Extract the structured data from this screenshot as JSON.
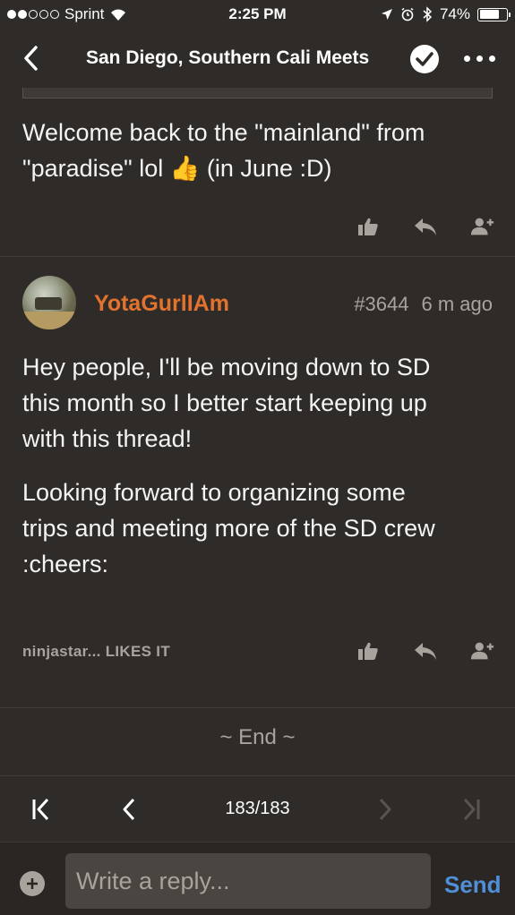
{
  "status_bar": {
    "carrier": "Sprint",
    "time": "2:25 PM",
    "battery": "74%",
    "battery_level": 0.74,
    "signal_bars_filled": 2,
    "signal_bars_total": 5
  },
  "nav": {
    "title": "San Diego, Southern Cali Meets",
    "back_icon": "chevron-left-icon",
    "check_icon": "check-icon",
    "more_icon": "more-icon"
  },
  "previous_post": {
    "text_line1": "Welcome back to the \"mainland\" from",
    "text_line2_before": "\"paradise\" lol",
    "emoji": "👍",
    "text_line2_after": "(in June :D)"
  },
  "post": {
    "username": "YotaGurlIAm",
    "number": "#3644",
    "time": "6 m ago",
    "paragraph1_line1": "Hey people, I'll be moving down to SD",
    "paragraph1_line2": "this month so I better start keeping up",
    "paragraph1_line3": "with this thread!",
    "paragraph2_line1": "Looking forward to organizing some",
    "paragraph2_line2": "trips and meeting more of the SD crew",
    "paragraph2_line3": ":cheers:",
    "likes": "ninjastar... LIKES IT"
  },
  "end_marker": "~ End ~",
  "pager": {
    "page": "183/183"
  },
  "reply": {
    "placeholder": "Write a reply...",
    "send_label": "Send"
  },
  "colors": {
    "background": "#2f2b28",
    "username": "#e2732e",
    "send": "#4f8fd6",
    "muted": "#a9a39d"
  }
}
